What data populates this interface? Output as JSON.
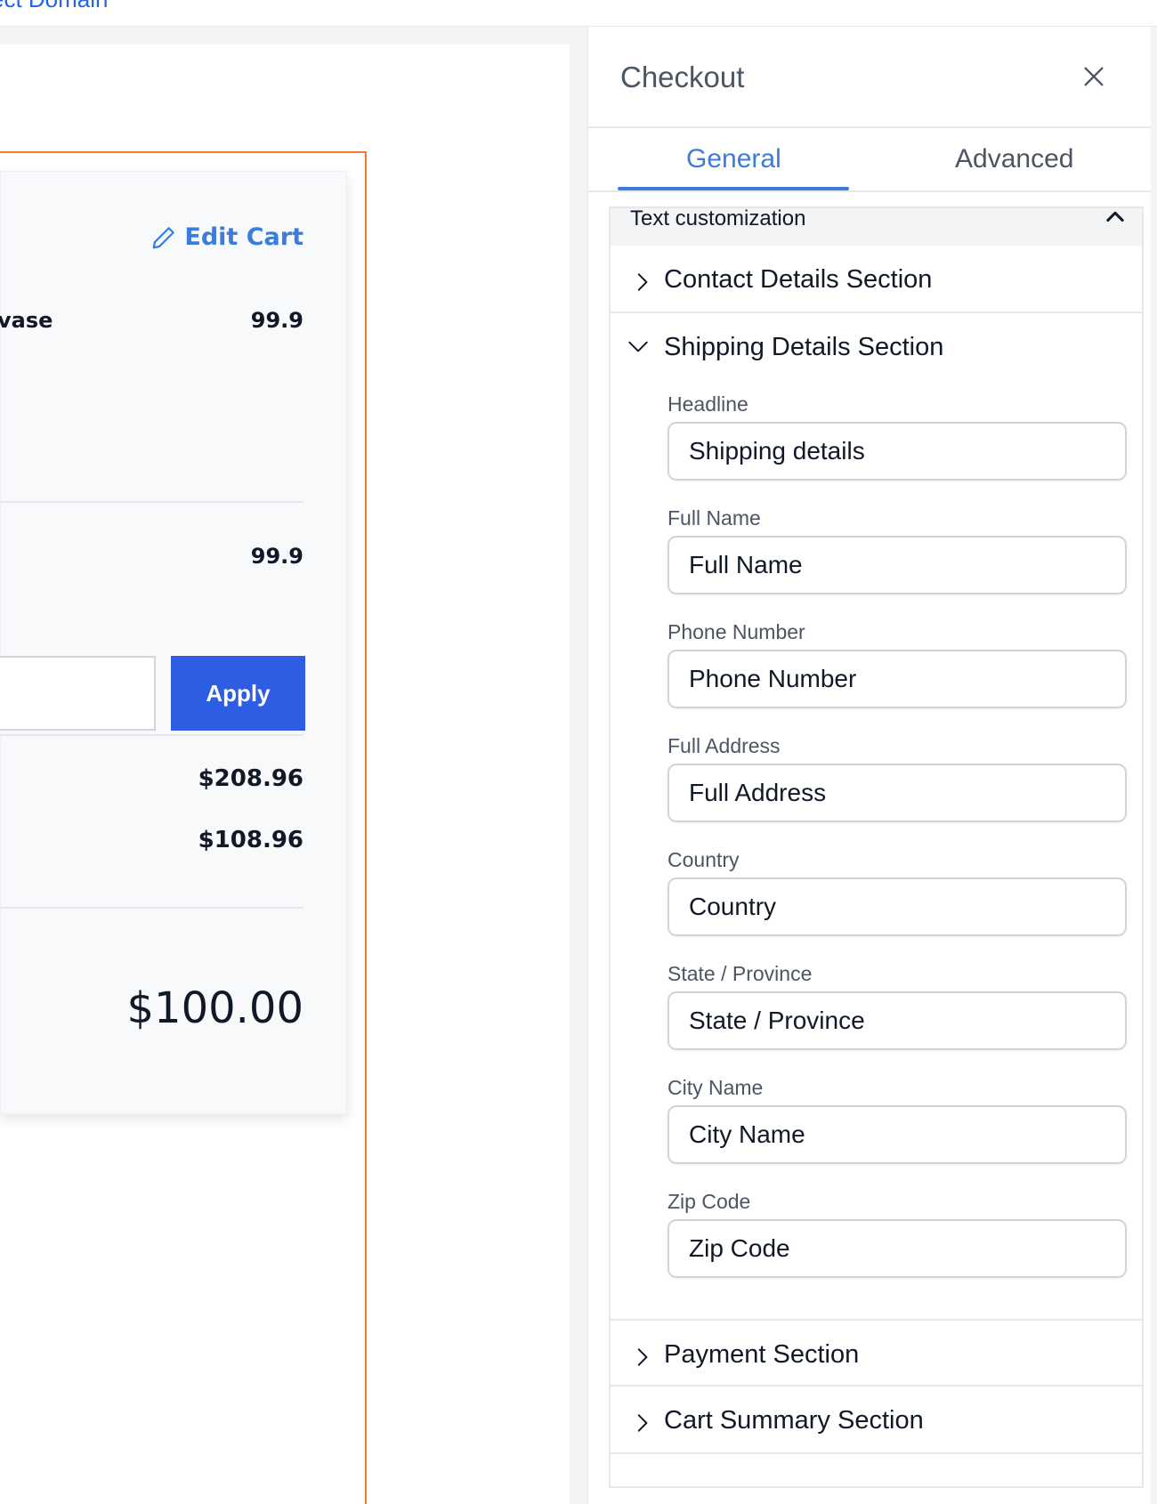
{
  "topbar": {
    "link_text": "ect Domain"
  },
  "preview": {
    "edit_cart_label": "Edit Cart",
    "item_name": "vase",
    "item_price": "99.9",
    "subtotal": "99.9",
    "coupon_placeholder": "",
    "apply_label": "Apply",
    "amount_1": "$208.96",
    "amount_2": "$108.96",
    "total": "$100.00"
  },
  "panel": {
    "title": "Checkout",
    "tabs": [
      {
        "label": "General",
        "active": true
      },
      {
        "label": "Advanced",
        "active": false
      }
    ],
    "accordion_title": "Text customization",
    "sections": [
      {
        "label": "Contact Details Section",
        "expanded": false
      },
      {
        "label": "Shipping Details Section",
        "expanded": true
      },
      {
        "label": "Payment Section",
        "expanded": false
      },
      {
        "label": "Cart Summary Section",
        "expanded": false
      }
    ],
    "fields": [
      {
        "label": "Headline",
        "value": "Shipping details"
      },
      {
        "label": "Full Name",
        "value": "Full Name"
      },
      {
        "label": "Phone Number",
        "value": "Phone Number"
      },
      {
        "label": "Full Address",
        "value": "Full Address"
      },
      {
        "label": "Country",
        "value": "Country"
      },
      {
        "label": "State / Province",
        "value": "State / Province"
      },
      {
        "label": "City Name",
        "value": "City Name"
      },
      {
        "label": "Zip Code",
        "value": "Zip Code"
      }
    ]
  },
  "colors": {
    "accent": "#3b7dd8",
    "apply_button": "#2d5de3",
    "selection_border": "#f07c2e"
  }
}
